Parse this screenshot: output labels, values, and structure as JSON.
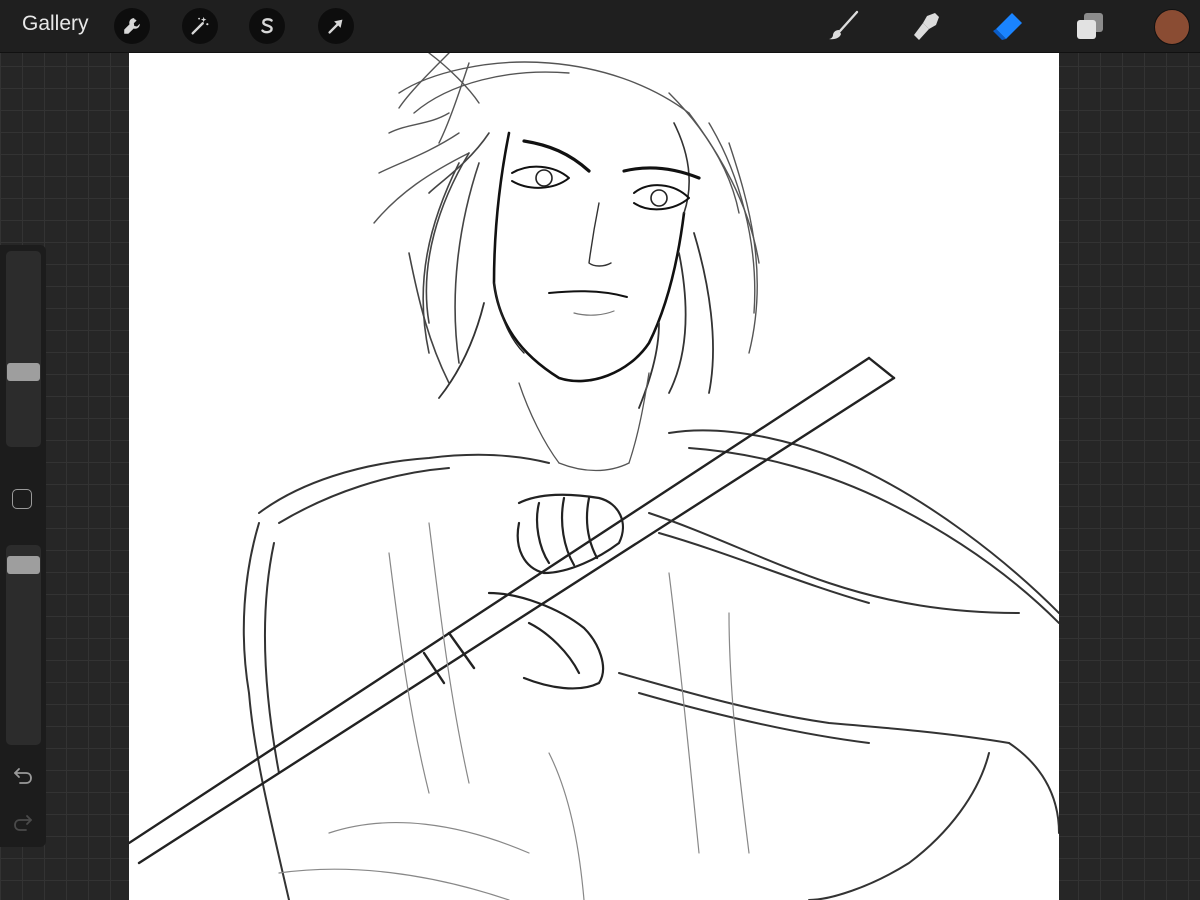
{
  "toolbar": {
    "gallery_label": "Gallery",
    "left_tools": [
      {
        "icon": "wrench-icon",
        "name": "actions"
      },
      {
        "icon": "magic-wand-icon",
        "name": "adjustments"
      },
      {
        "icon": "selection-s-icon",
        "name": "selection"
      },
      {
        "icon": "arrow-cursor-icon",
        "name": "transform"
      }
    ],
    "right_tools": [
      {
        "icon": "brush-icon",
        "name": "paint"
      },
      {
        "icon": "smudge-icon",
        "name": "smudge"
      },
      {
        "icon": "eraser-icon",
        "name": "erase",
        "active": true
      },
      {
        "icon": "layers-icon",
        "name": "layers"
      }
    ],
    "current_color": "#8a4c33",
    "active_tool_color": "#1a84ff"
  },
  "sidebar": {
    "brush_size_level": 0.37,
    "brush_opacity_level": 0.95,
    "icons": [
      "square-modify-icon",
      "undo-icon",
      "redo-icon"
    ]
  }
}
